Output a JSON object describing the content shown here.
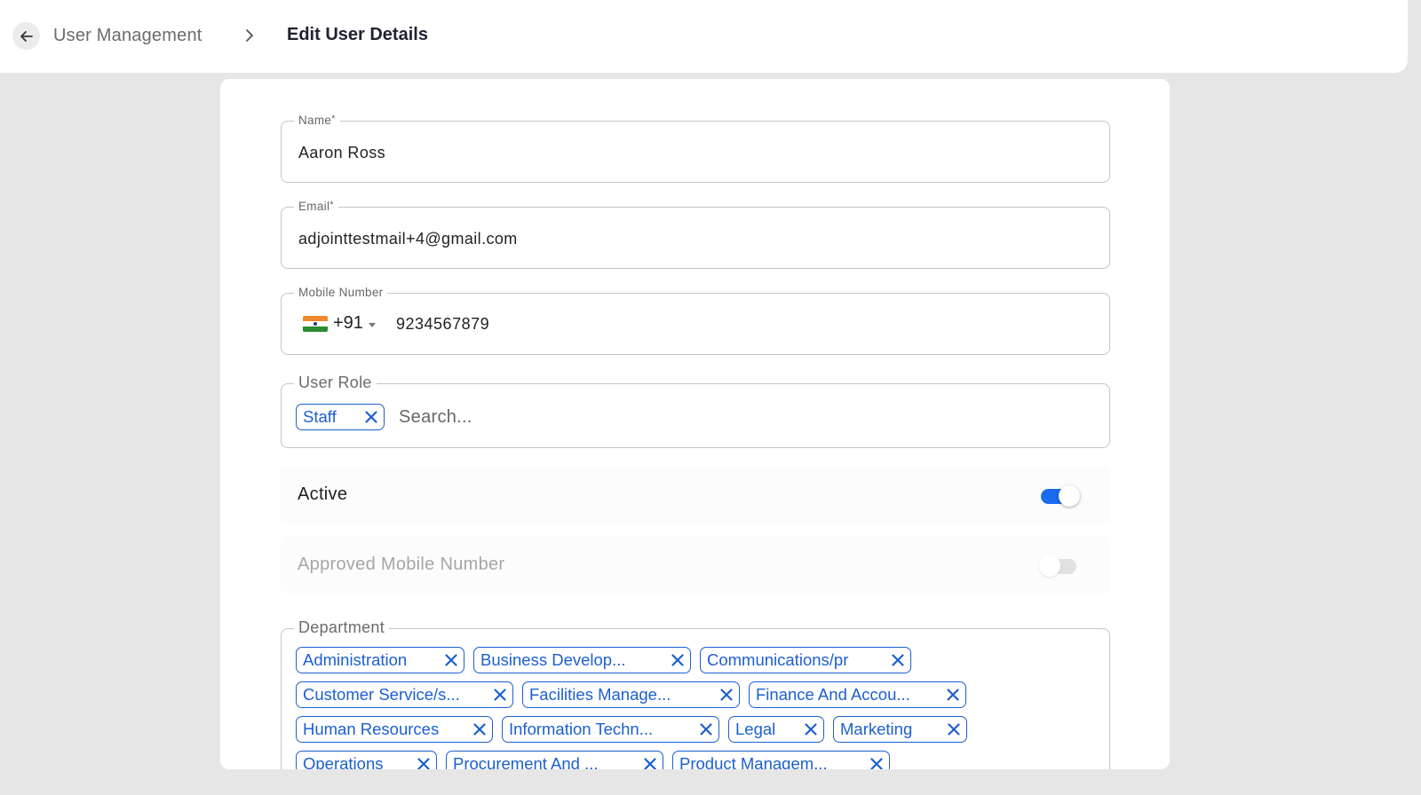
{
  "header": {
    "back_label": "Back",
    "breadcrumb_parent": "User Management",
    "breadcrumb_current": "Edit User Details"
  },
  "form": {
    "name": {
      "label": "Name",
      "required_mark": "*",
      "value": "Aaron Ross"
    },
    "email": {
      "label": "Email",
      "required_mark": "*",
      "value": "adjointtestmail+4@gmail.com"
    },
    "mobile": {
      "label": "Mobile Number",
      "country_flag": "india-flag-icon",
      "dial_code": "+91",
      "value": "9234567879"
    },
    "user_role": {
      "label": "User Role",
      "chips": [
        "Staff"
      ],
      "placeholder": "Search..."
    },
    "active": {
      "label": "Active",
      "enabled": true
    },
    "approved_mobile": {
      "label": "Approved Mobile Number",
      "enabled": false,
      "disabled": true
    },
    "department": {
      "label": "Department",
      "rows": [
        [
          "Administration",
          "Business Develop...",
          "Communications/pr"
        ],
        [
          "Customer Service/s...",
          "Facilities Manage...",
          "Finance And Accou..."
        ],
        [
          "Human Resources",
          "Information Techn...",
          "Legal",
          "Marketing"
        ],
        [
          "Operations",
          "Procurement And ...",
          "Product Managem..."
        ]
      ]
    }
  },
  "colors": {
    "accent": "#1c5fd0",
    "toggle_on": "#1a6bf0",
    "toggle_off": "#e2e2e2",
    "background": "#e6e6e6"
  }
}
